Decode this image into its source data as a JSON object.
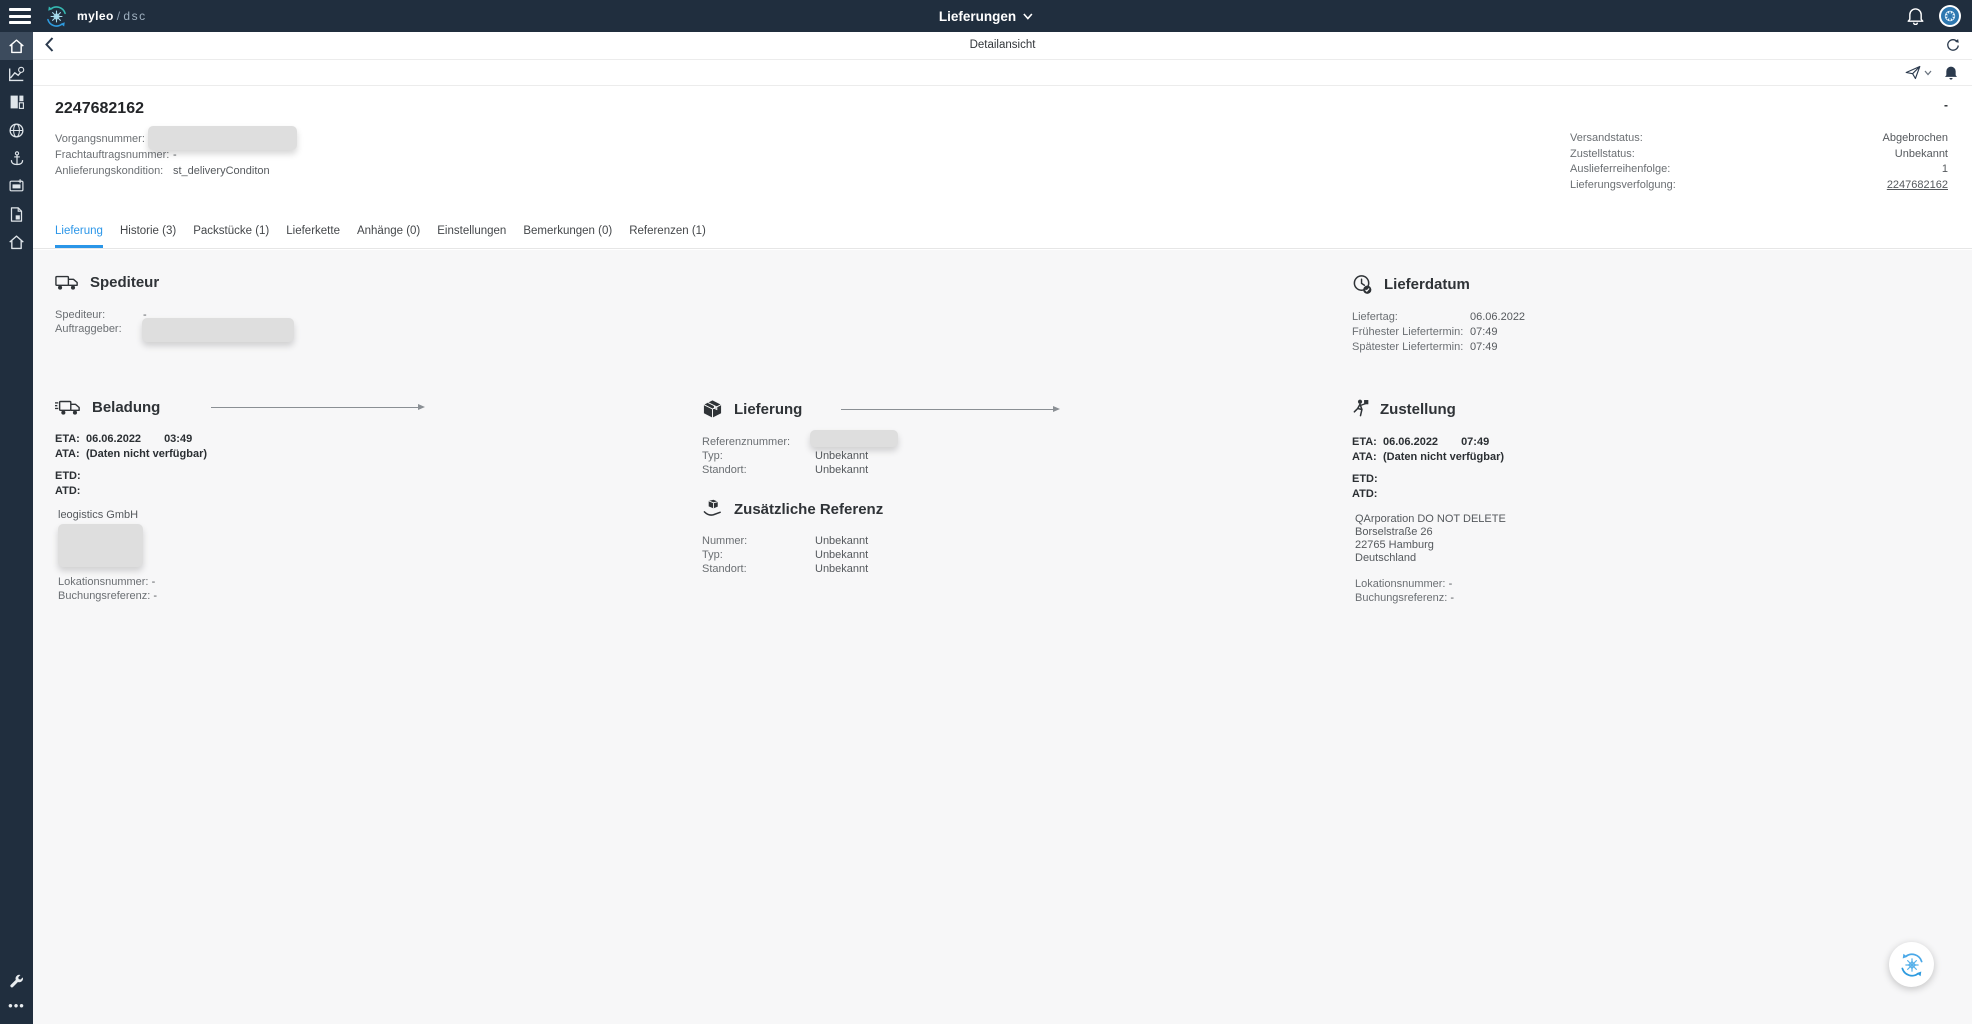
{
  "colors": {
    "topbar_bg": "#202e3e",
    "accent_blue": "#2b96e8",
    "brand_teal": "#35b8b2",
    "content_bg": "#f7f7f8",
    "redaction_gray": "#dedede"
  },
  "topbar": {
    "brand": "myleo",
    "brand_sep": "/",
    "brand_suffix": "dsc",
    "title": "Lieferungen"
  },
  "detailbar": {
    "title": "Detailansicht"
  },
  "header": {
    "title": "2247682162",
    "corner_value": "-",
    "left_fields": [
      {
        "label": "Vorgangsnummer:",
        "value": ""
      },
      {
        "label": "Frachtauftragsnummer:",
        "value": "-"
      },
      {
        "label": "Anlieferungskondition:",
        "value": "st_deliveryConditon"
      }
    ],
    "right_fields": [
      {
        "label": "Versandstatus:",
        "value": "Abgebrochen"
      },
      {
        "label": "Zustellstatus:",
        "value": "Unbekannt"
      },
      {
        "label": "Auslieferreihenfolge:",
        "value": "1"
      },
      {
        "label": "Lieferungsverfolgung:",
        "value": "2247682162"
      }
    ]
  },
  "tabs": [
    {
      "label": "Lieferung",
      "active": true
    },
    {
      "label": "Historie (3)",
      "active": false
    },
    {
      "label": "Packstücke (1)",
      "active": false
    },
    {
      "label": "Lieferkette",
      "active": false
    },
    {
      "label": "Anhänge (0)",
      "active": false
    },
    {
      "label": "Einstellungen",
      "active": false
    },
    {
      "label": "Bemerkungen (0)",
      "active": false
    },
    {
      "label": "Referenzen (1)",
      "active": false
    }
  ],
  "spediteur": {
    "title": "Spediteur",
    "rows": [
      {
        "label": "Spediteur:",
        "value": "-"
      },
      {
        "label": "Auftraggeber:",
        "value": ""
      }
    ]
  },
  "lieferdatum": {
    "title": "Lieferdatum",
    "rows": [
      {
        "label": "Liefertag:",
        "value": "06.06.2022"
      },
      {
        "label": "Frühester Liefertermin:",
        "value": "07:49"
      },
      {
        "label": "Spätester Liefertermin:",
        "value": "07:49"
      }
    ]
  },
  "beladung": {
    "title": "Beladung",
    "eta": {
      "label": "ETA:",
      "date": "06.06.2022",
      "time": "03:49"
    },
    "ata": {
      "label": "ATA:",
      "value": "(Daten nicht verfügbar)"
    },
    "etd": {
      "label": "ETD:",
      "value": ""
    },
    "atd": {
      "label": "ATD:",
      "value": ""
    },
    "company": "leogistics GmbH",
    "rows": [
      {
        "label": "Lokationsnummer:",
        "value": "-"
      },
      {
        "label": "Buchungsreferenz:",
        "value": "-"
      }
    ]
  },
  "lieferung_sec": {
    "title": "Lieferung",
    "rows": [
      {
        "label": "Referenznummer:",
        "value": ""
      },
      {
        "label": "Typ:",
        "value": "Unbekannt"
      },
      {
        "label": "Standort:",
        "value": "Unbekannt"
      }
    ]
  },
  "zusatz": {
    "title": "Zusätzliche Referenz",
    "rows": [
      {
        "label": "Nummer:",
        "value": "Unbekannt"
      },
      {
        "label": "Typ:",
        "value": "Unbekannt"
      },
      {
        "label": "Standort:",
        "value": "Unbekannt"
      }
    ]
  },
  "zustellung": {
    "title": "Zustellung",
    "eta": {
      "label": "ETA:",
      "date": "06.06.2022",
      "time": "07:49"
    },
    "ata": {
      "label": "ATA:",
      "value": "(Daten nicht verfügbar)"
    },
    "etd": {
      "label": "ETD:",
      "value": ""
    },
    "atd": {
      "label": "ATD:",
      "value": ""
    },
    "company": "QArporation DO NOT DELETE",
    "address": [
      "Borselstraße 26",
      "22765 Hamburg",
      "Deutschland"
    ],
    "rows": [
      {
        "label": "Lokationsnummer:",
        "value": "-"
      },
      {
        "label": "Buchungsreferenz:",
        "value": "-"
      }
    ]
  }
}
